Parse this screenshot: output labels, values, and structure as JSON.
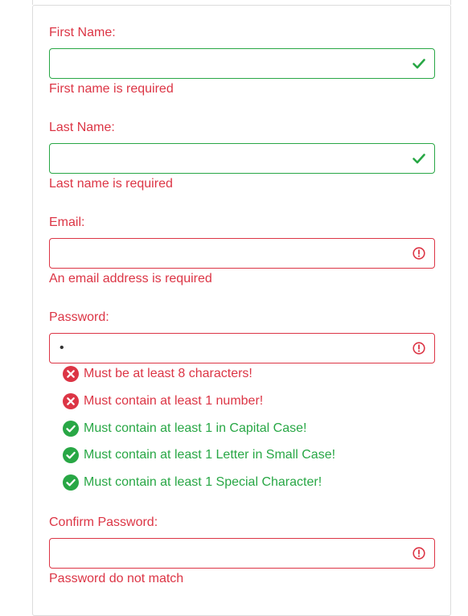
{
  "colors": {
    "error": "#dc3545",
    "success": "#28a745"
  },
  "first_name": {
    "label": "First Name:",
    "value": "",
    "status": "valid",
    "icon": "check-icon",
    "error": "First name is required"
  },
  "last_name": {
    "label": "Last Name:",
    "value": "",
    "status": "valid",
    "icon": "check-icon",
    "error": "Last name is required"
  },
  "email": {
    "label": "Email:",
    "value": "",
    "status": "invalid",
    "icon": "alert-circle-icon",
    "error": "An email address is required"
  },
  "password": {
    "label": "Password:",
    "value": "•",
    "status": "invalid",
    "icon": "alert-circle-icon",
    "rules": [
      {
        "text": "Must be at least 8 characters!",
        "passed": false,
        "icon": "x-circle-icon"
      },
      {
        "text": "Must contain at least 1 number!",
        "passed": false,
        "icon": "x-circle-icon"
      },
      {
        "text": "Must contain at least 1 in Capital Case!",
        "passed": true,
        "icon": "check-circle-icon"
      },
      {
        "text": "Must contain at least 1 Letter in Small Case!",
        "passed": true,
        "icon": "check-circle-icon"
      },
      {
        "text": "Must contain at least 1 Special Character!",
        "passed": true,
        "icon": "check-circle-icon"
      }
    ]
  },
  "confirm_password": {
    "label": "Confirm Password:",
    "value": "",
    "status": "invalid",
    "icon": "alert-circle-icon",
    "error": "Password do not match"
  }
}
